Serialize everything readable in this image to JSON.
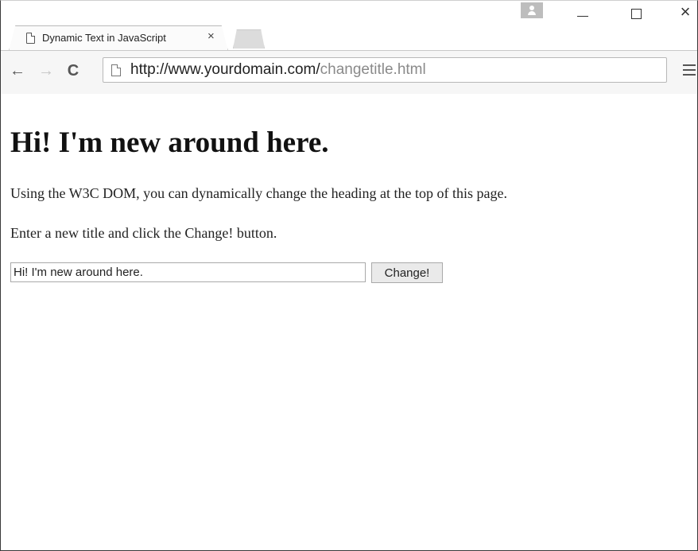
{
  "browser": {
    "tab": {
      "title": "Dynamic Text in JavaScript",
      "close_glyph": "×"
    },
    "window_controls": {
      "close_glyph": "×"
    },
    "nav": {
      "back_glyph": "←",
      "forward_glyph": "→",
      "reload_glyph": "C"
    },
    "address": {
      "host": "http://www.yourdomain.com/",
      "path": "changetitle.html"
    }
  },
  "page": {
    "heading": "Hi! I'm new around here.",
    "paragraph1": "Using the W3C DOM, you can dynamically change the heading at the top of this page.",
    "paragraph2": "Enter a new title and click the Change! button.",
    "title_input_value": "Hi! I'm new around here.",
    "change_button_label": "Change!"
  },
  "icons": [
    "page-icon",
    "profile-icon",
    "minimize-icon",
    "maximize-icon",
    "close-icon",
    "back-arrow-icon",
    "forward-arrow-icon",
    "reload-icon",
    "menu-icon"
  ]
}
